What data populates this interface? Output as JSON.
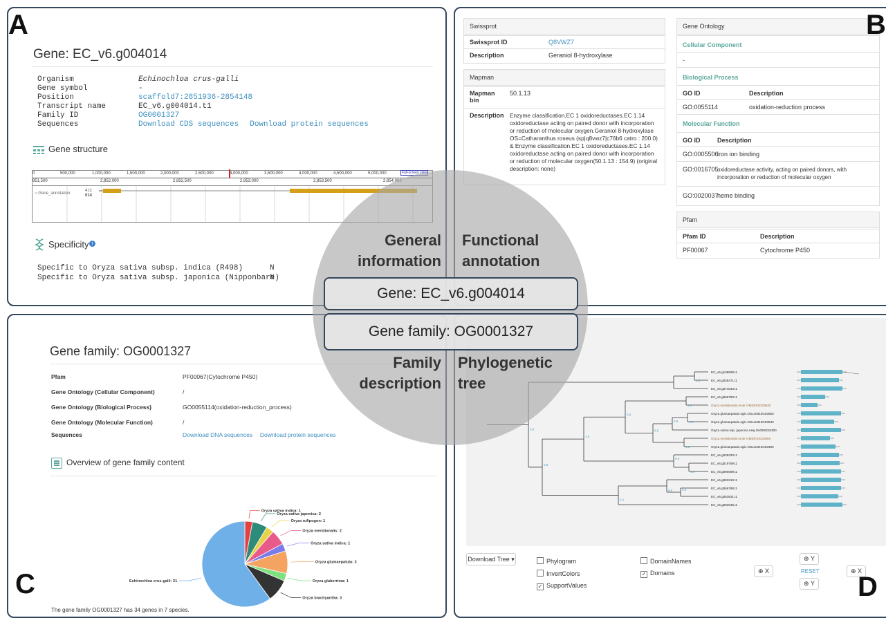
{
  "letters": {
    "a": "A",
    "b": "B",
    "c": "C",
    "d": "D"
  },
  "panel_a": {
    "title": "Gene: EC_v6.g004014",
    "rows": [
      {
        "k": "Organism",
        "v": "Echinochloa crus-galli"
      },
      {
        "k": "Gene symbol",
        "v": "-"
      },
      {
        "k": "Position",
        "v": "scaffold7:2851936-2854148"
      },
      {
        "k": "Transcript name",
        "v": "EC_v6.g004014.t1"
      },
      {
        "k": "Family ID",
        "v": "OG0001327"
      },
      {
        "k": "Sequences",
        "v": "Download CDS sequences",
        "v2": "Download protein sequences"
      }
    ],
    "structure_title": "Gene structure",
    "ruler_top": [
      "0",
      "500,000",
      "1,000,000",
      "1,500,000",
      "2,000,000",
      "2,500,000",
      "3,000,000",
      "3,500,000",
      "4,000,000",
      "4,500,000",
      "5,000,000"
    ],
    "ruler_bottom": [
      "851,500",
      "2,852,000",
      "2,852,500",
      "2,853,000",
      "2,853,500",
      "2,854,000"
    ],
    "fullscreen": "Full-screen view",
    "track_label": "Gene_annotation",
    "track_id": "4.t1",
    "track_id2": "014",
    "specificity_title": "Specificity",
    "specific_rows": [
      {
        "t": "Specific to Oryza sativa subsp. indica (R498)",
        "v": "N"
      },
      {
        "t": "Specific to Oryza sativa subsp. japonica (Nipponbare)",
        "v": "N"
      }
    ]
  },
  "panel_b": {
    "swissprot": {
      "header": "Swissprot",
      "id_label": "Swissprot ID",
      "id": "Q8VWZ7",
      "desc_label": "Description",
      "desc": "Geraniol 8-hydroxylase"
    },
    "mapman": {
      "header": "Mapman",
      "bin_label": "Mapman bin",
      "bin": "50.1.13",
      "desc_label": "Description",
      "desc": "Enzyme classification.EC 1 oxidoreductases.EC 1.14 oxidoreductase acting on paired donor with incorporation or reduction of molecular oxygen.Geraniol 8-hydroxylase OS=Catharanthus roseus (sp|q8vwz7|c76b6 catro : 200.0) & Enzyme classification.EC 1 oxidoreductases.EC 1.14 oxidoreductase acting on paired donor with incorporation or reduction of molecular oxygen(50.1.13 : 154.9) (original description: none)"
    },
    "go": {
      "header": "Gene Ontology",
      "cc": "Cellular Component",
      "cc_val": "-",
      "bp": "Biological Process",
      "goid": "GO ID",
      "desc": "Description",
      "bp_rows": [
        {
          "id": "GO:0055114",
          "d": "oxidation-reduction process"
        }
      ],
      "mf": "Molecular Function",
      "mf_rows": [
        {
          "id": "GO:0005506",
          "d": "iron ion binding"
        },
        {
          "id": "GO:0016705",
          "d": "oxidoreductase activity, acting on paired donors, with incorporation or reduction of molecular oxygen"
        },
        {
          "id": "GO:0020037",
          "d": "heme binding"
        }
      ]
    },
    "pfam": {
      "header": "Pfam",
      "id_label": "Pfam ID",
      "desc_label": "Description",
      "id": "PF00067",
      "desc": "Cytochrome P450"
    }
  },
  "panel_c": {
    "title": "Gene family: OG0001327",
    "rows": [
      {
        "k": "Pfam",
        "v": "PF00067(Cytochrome P450)"
      },
      {
        "k": "Gene Ontology (Cellular Component)",
        "v": "/"
      },
      {
        "k": "Gene Ontology (Biological Process)",
        "v": "GO0055114(oxidation-reduction_process)"
      },
      {
        "k": "Gene Ontology (Molecular Function)",
        "v": "/"
      },
      {
        "k": "Sequences",
        "v": "Download DNA sequences",
        "v2": "Download protein sequences"
      }
    ],
    "overview_title": "Overview of gene family content",
    "footer": "The gene family OG0001327 has 34 genes in 7 species.",
    "colors": [
      "#6fb0e8",
      "#333333",
      "#7ee07e",
      "#f4a460",
      "#7b7bea",
      "#e85a8a",
      "#e8d24a",
      "#2e8b7a",
      "#e84040"
    ]
  },
  "chart_data": {
    "type": "pie",
    "categories": [
      "Echinochloa crus-galli",
      "Oryza brachyantha",
      "Oryza glaberrima",
      "Oryza glumaepatula",
      "Oryza sativa indica",
      "Oryza meridionalis",
      "Oryza rufipogon",
      "Oryza sativa japonica",
      "Oryza sativa indica"
    ],
    "values": [
      21,
      3,
      1,
      3,
      1,
      2,
      1,
      2,
      1
    ],
    "labels": [
      "Echinochloa crus-galli: 21",
      "Oryza brachyantha: 3",
      "Oryza glaberrima: 1",
      "Oryza glumaepatula: 3",
      "Oryza sativa indica: 1",
      "Oryza meridionalis: 2",
      "Oryza rufipogon: 1",
      "Oryza sativa japonica: 2",
      "Oryza sativa indica: 1"
    ]
  },
  "panel_d": {
    "leaves": [
      "EC_v6.g105590.t1",
      "EC_v6.g035471.t1",
      "EC_v6.g074033.t1",
      "EC_v6.g066780.t1",
      "Oryza meridionalis omer OMER03G09930",
      "Oryza glumaepatula oglu OGLUM10G03560",
      "Oryza glumaepatula oglu OGLUM10G03530",
      "Oryza sativa ssp. japonica osaj Os09t0226300",
      "Oryza meridionalis omer OMER10G02900",
      "Oryza glumaepatula oglu OGLUM10G03480",
      "EC_v6.g035333.t1",
      "EC_v6.g019769.t1",
      "EC_v6.g090099.t1",
      "EC_v6.g083310.t1",
      "EC_v6.g066788.t1",
      "EC_v6.g053831.t1",
      "EC_v6.g092545.t1"
    ],
    "download_tree": "Download Tree",
    "opts": {
      "phylogram": "Phylogram",
      "invert": "InvertColors",
      "support": "SupportValues",
      "domainnames": "DomainNames",
      "domains": "Domains"
    },
    "zoom_y": "Y",
    "zoom_x": "X",
    "reset": "RESET"
  },
  "overlay": {
    "general": "General",
    "information": "information",
    "functional": "Functional",
    "annotation": "annotation",
    "family": "Family",
    "description": "description",
    "phylogenetic": "Phylogenetic",
    "tree": "tree",
    "gene_pill": "Gene: EC_v6.g004014",
    "family_pill": "Gene family: OG0001327"
  }
}
